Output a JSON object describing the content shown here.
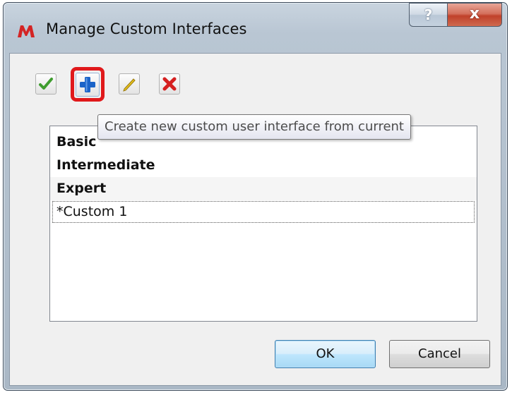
{
  "window": {
    "title": "Manage Custom Interfaces",
    "help_label": "?",
    "close_label": "x"
  },
  "toolbar": {
    "apply_icon": "checkmark-icon",
    "new_icon": "plus-icon",
    "rename_icon": "pencil-icon",
    "delete_icon": "delete-x-icon",
    "highlight_color": "#e0191b"
  },
  "tooltip": {
    "text": "Create new custom user interface from current"
  },
  "interfaces": {
    "items": [
      {
        "label": "Basic"
      },
      {
        "label": "Intermediate"
      },
      {
        "label": "Expert"
      },
      {
        "label": "*Custom 1"
      }
    ],
    "focused_index": 3
  },
  "buttons": {
    "ok_label": "OK",
    "cancel_label": "Cancel"
  }
}
